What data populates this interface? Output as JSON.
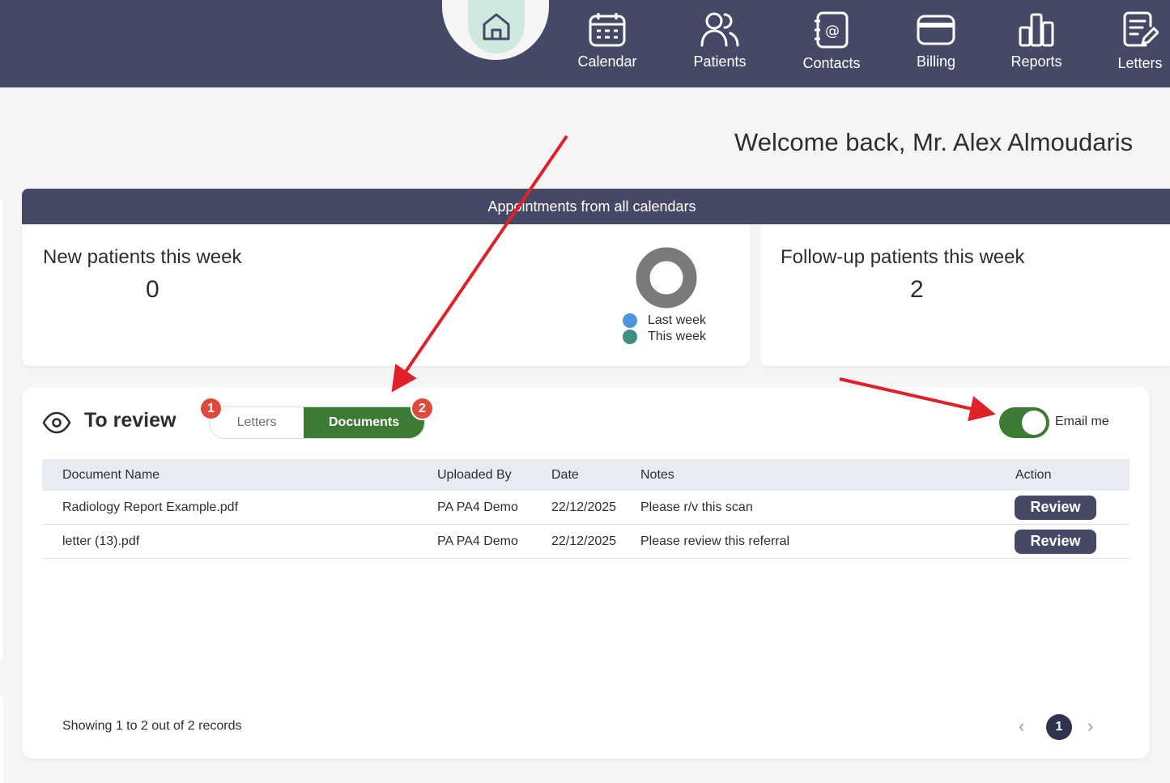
{
  "nav": {
    "items": [
      {
        "label": "Calendar",
        "icon": "calendar-icon"
      },
      {
        "label": "Patients",
        "icon": "patients-icon"
      },
      {
        "label": "Contacts",
        "icon": "contacts-icon"
      },
      {
        "label": "Billing",
        "icon": "billing-icon"
      },
      {
        "label": "Reports",
        "icon": "reports-icon"
      },
      {
        "label": "Letters",
        "icon": "letters-icon"
      }
    ],
    "home_icon": "home-icon"
  },
  "welcome": "Welcome back, Mr. Alex Almoudaris",
  "appointments_header": "Appointments from all calendars",
  "stats": {
    "new_patients": {
      "title": "New patients this week",
      "value": "0"
    },
    "followup_patients": {
      "title": "Follow-up patients this week",
      "value": "2"
    },
    "legend": [
      {
        "label": "Last week",
        "color": "#4a97e0"
      },
      {
        "label": "This week",
        "color": "#3d8f86"
      }
    ]
  },
  "review": {
    "title": "To review",
    "tabs": {
      "letters": "Letters",
      "documents": "Documents",
      "active": "documents"
    },
    "badges": {
      "letters": "1",
      "documents": "2"
    },
    "email_me": "Email me",
    "email_toggle_on": true,
    "columns": [
      "Document Name",
      "Uploaded By",
      "Date",
      "Notes",
      "Action"
    ],
    "rows": [
      {
        "name": "Radiology Report Example.pdf",
        "uploaded_by": "PA PA4 Demo",
        "date": "22/12/2025",
        "notes": "Please r/v this scan",
        "action": "Review"
      },
      {
        "name": "letter (13).pdf",
        "uploaded_by": "PA PA4 Demo",
        "date": "22/12/2025",
        "notes": "Please review this referral",
        "action": "Review"
      }
    ],
    "showing": "Showing 1 to 2 out of 2 records",
    "pagination": {
      "current": "1",
      "prev": "‹",
      "next": "›"
    }
  },
  "colors": {
    "navbar": "#464966",
    "accent_green": "#3b7b34",
    "badge_red": "#e04a3a",
    "annotation_arrow": "#e0212a"
  }
}
